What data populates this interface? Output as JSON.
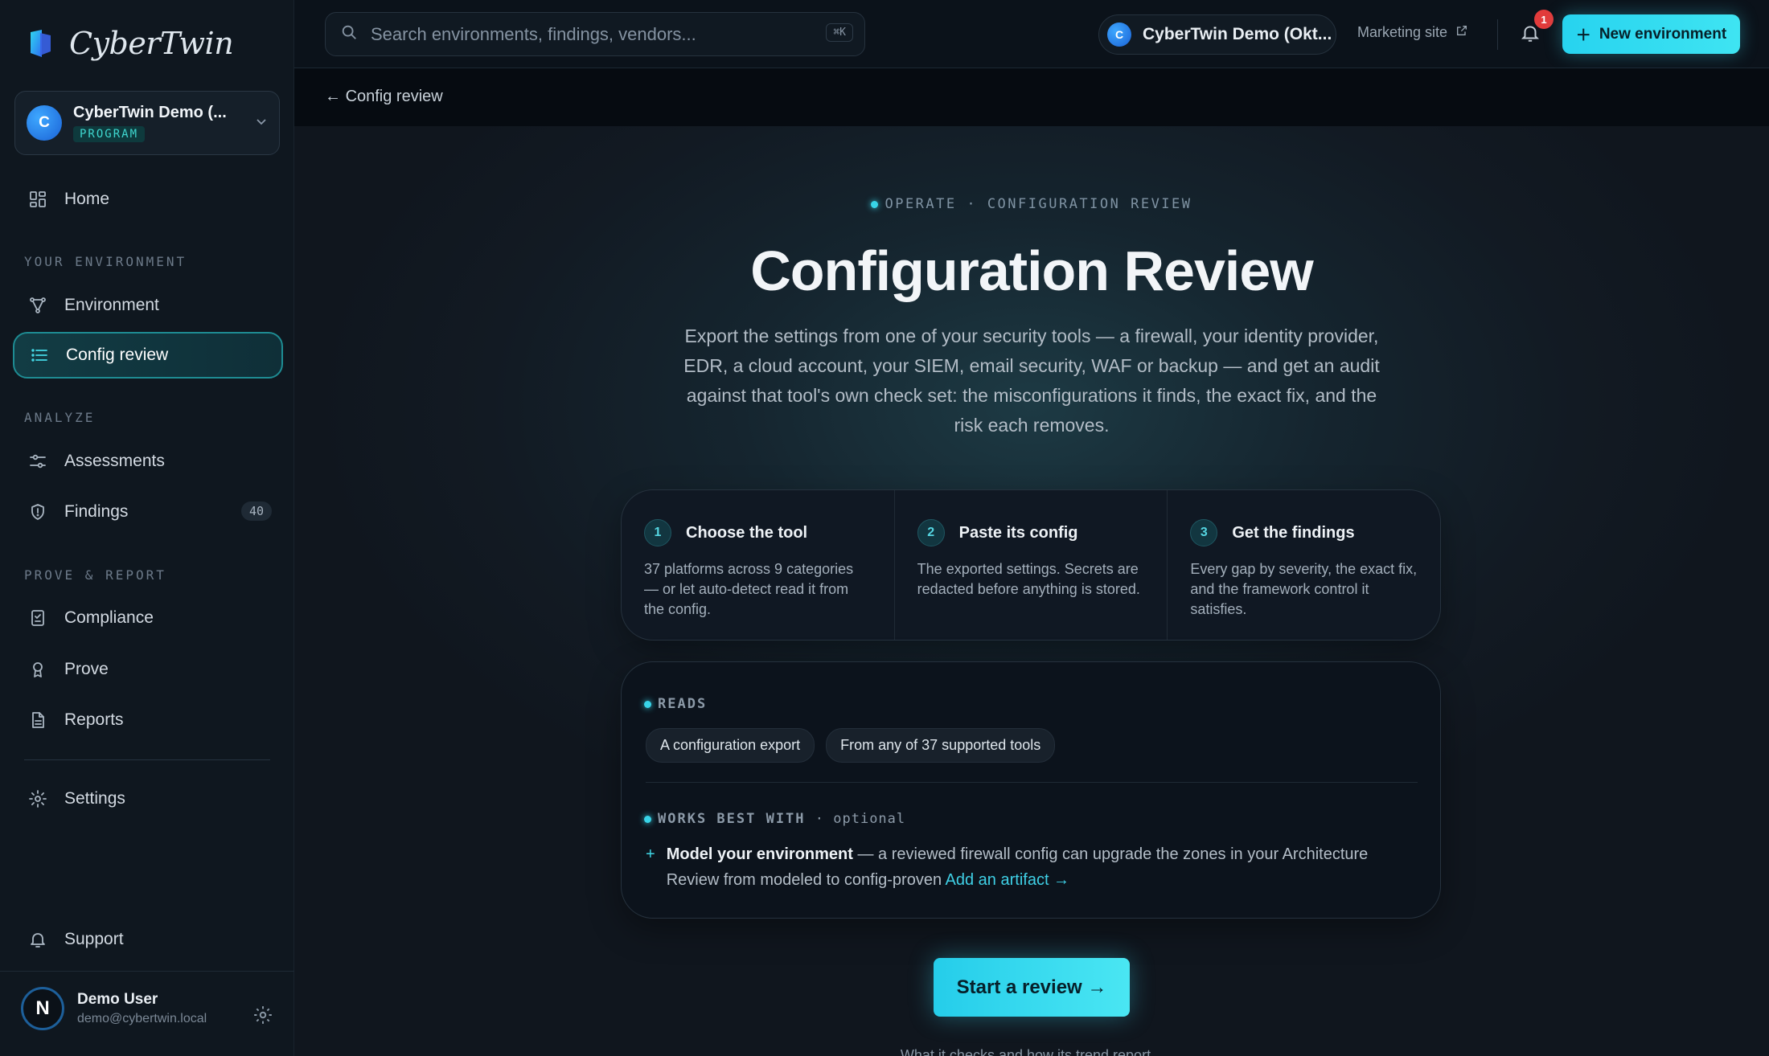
{
  "app": {
    "brand": "CyberTwin",
    "org_name": "CyberTwin Demo (...",
    "org_badge": "PROGRAM",
    "org_initial": "C"
  },
  "sidebar": {
    "home": "Home",
    "section_env": "YOUR ENVIRONMENT",
    "environment": "Environment",
    "config_review": "Config review",
    "section_analyze": "ANALYZE",
    "assessments": "Assessments",
    "findings": "Findings",
    "findings_count": "40",
    "section_prove": "PROVE & REPORT",
    "compliance": "Compliance",
    "prove": "Prove",
    "reports": "Reports",
    "settings": "Settings",
    "support": "Support"
  },
  "user": {
    "initial": "N",
    "name": "Demo User",
    "email": "demo@cybertwin.local"
  },
  "topbar": {
    "search_placeholder": "Search environments, findings, vendors...",
    "search_shortcut": "⌘K",
    "org_pill": "CyberTwin Demo (Okt...",
    "org_pill_initial": "C",
    "marketing": "Marketing site",
    "notif_count": "1",
    "new_env": "New environment"
  },
  "breadcrumb": {
    "back": "Config review"
  },
  "hero": {
    "eyebrow": "OPERATE · CONFIGURATION REVIEW",
    "title": "Configuration Review",
    "description": "Export the settings from one of your security tools — a firewall, your identity provider, EDR, a cloud account, your SIEM, email security, WAF or backup — and get an audit against that tool's own check set: the misconfigurations it finds, the exact fix, and the risk each removes."
  },
  "steps": [
    {
      "num": "1",
      "title": "Choose the tool",
      "body": "37 platforms across 9 categories — or let auto-detect read it from the config."
    },
    {
      "num": "2",
      "title": "Paste its config",
      "body": "The exported settings. Secrets are redacted before anything is stored."
    },
    {
      "num": "3",
      "title": "Get the findings",
      "body": "Every gap by severity, the exact fix, and the framework control it satisfies."
    }
  ],
  "reads": {
    "label": "READS",
    "chips": [
      "A configuration export",
      "From any of 37 supported tools"
    ],
    "works_label": "WORKS BEST WITH",
    "works_optional": "· optional",
    "works_title": "Model your environment",
    "works_text": " — a reviewed firewall config can upgrade the zones in your Architecture Review from modeled to config-proven ",
    "works_link": "Add an artifact →"
  },
  "cta": {
    "label": "Start a review →",
    "below": "What it checks and how its trend report..."
  }
}
